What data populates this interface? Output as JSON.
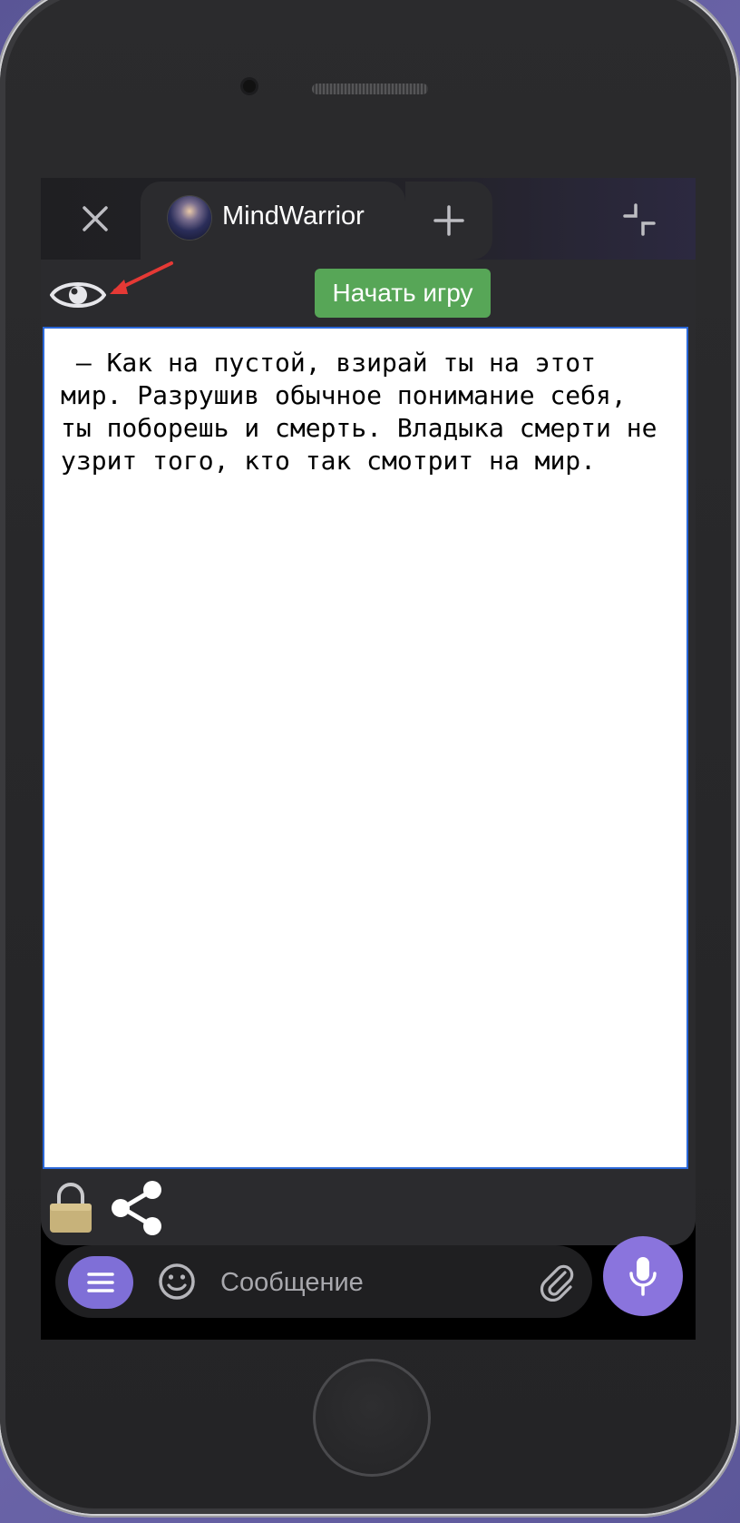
{
  "tabs": {
    "active_title": "MindWarrior"
  },
  "toolbar": {
    "start_button_label": "Начать игру"
  },
  "content": {
    "text": " – Как на пустой, взирай ты на этот мир. Разрушив обычное понимание себя, ты поборешь и смерть. Владыка смерти не узрит того, кто так смотрит на мир."
  },
  "composer": {
    "placeholder": "Сообщение"
  },
  "colors": {
    "start_button": "#57a657",
    "accent": "#8a74dd",
    "text_border": "#2a67d8",
    "arrow": "#e53935"
  },
  "icons": [
    "close-icon",
    "plus-icon",
    "minimize-icon",
    "eye-icon",
    "lock-icon",
    "share-icon",
    "menu-icon",
    "emoji-icon",
    "attach-icon",
    "mic-icon"
  ]
}
